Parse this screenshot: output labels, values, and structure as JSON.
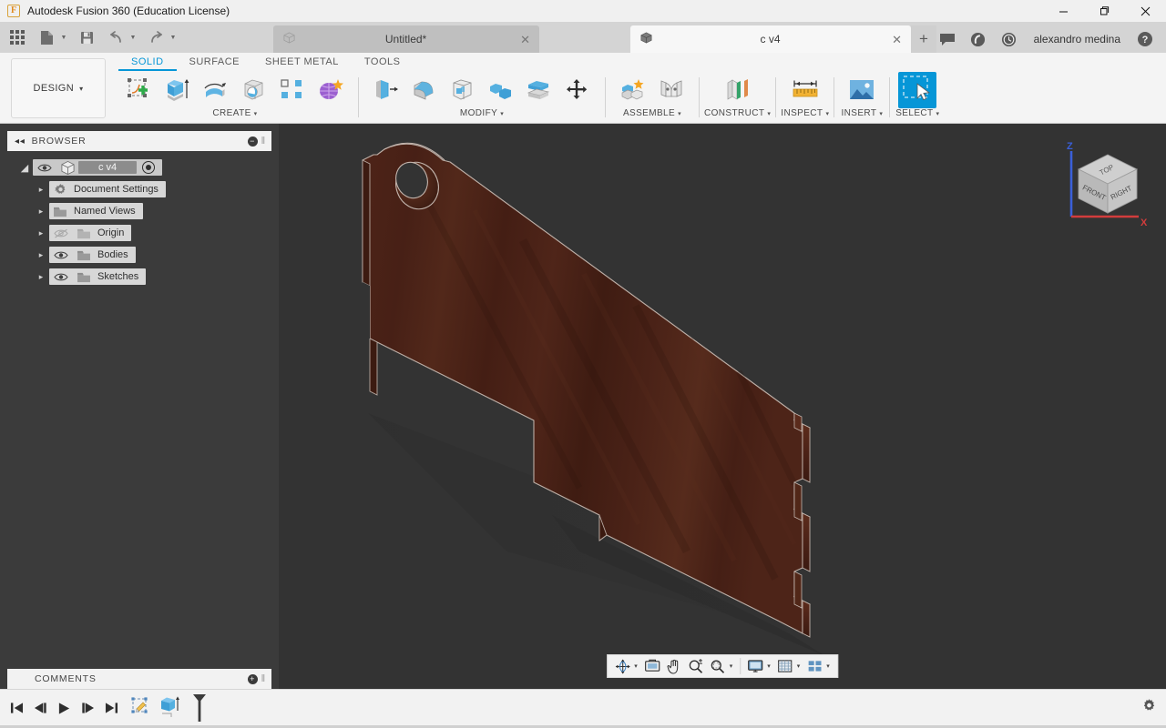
{
  "window": {
    "app_title": "Autodesk Fusion 360 (Education License)",
    "logo_letter": "F",
    "minimize_label": "—",
    "maximize_label": "❐",
    "close_label": "✕"
  },
  "quick_access": {
    "items": [
      {
        "name": "app-grid-icon",
        "label": "Show Data Panel"
      },
      {
        "name": "file-icon",
        "label": "File"
      },
      {
        "name": "save-icon",
        "label": "Save"
      },
      {
        "name": "undo-icon",
        "label": "Undo"
      },
      {
        "name": "redo-icon",
        "label": "Redo"
      }
    ]
  },
  "document_tabs": [
    {
      "label": "Untitled*",
      "active": false,
      "close_label": "✕"
    },
    {
      "label": "c v4",
      "active": true,
      "close_label": "✕"
    }
  ],
  "tab_strip_right": {
    "new_tab_label": "+",
    "buttons": [
      {
        "name": "comments-icon",
        "label": "Comments"
      },
      {
        "name": "job-status-icon",
        "label": "Job Status"
      },
      {
        "name": "recent-icon",
        "label": "Recent"
      }
    ],
    "username": "alexandro medina",
    "help_label": "?"
  },
  "ribbon": {
    "workspace_label": "DESIGN",
    "workspace_caret": "▾",
    "tabs": [
      {
        "label": "SOLID",
        "active": true
      },
      {
        "label": "SURFACE",
        "active": false
      },
      {
        "label": "SHEET METAL",
        "active": false
      },
      {
        "label": "TOOLS",
        "active": false
      }
    ],
    "panels": [
      {
        "label": "CREATE",
        "caret": "▾",
        "tools": [
          {
            "name": "create-sketch-icon",
            "label": "Create Sketch"
          },
          {
            "name": "extrude-icon",
            "label": "Extrude"
          },
          {
            "name": "revolve-icon",
            "label": "Revolve"
          },
          {
            "name": "sphere-icon",
            "label": "Sphere"
          },
          {
            "name": "pattern-icon",
            "label": "Pattern"
          },
          {
            "name": "form-icon",
            "label": "Create Form"
          }
        ]
      },
      {
        "label": "MODIFY",
        "caret": "▾",
        "tools": [
          {
            "name": "press-pull-icon",
            "label": "Press Pull"
          },
          {
            "name": "fillet-icon",
            "label": "Fillet"
          },
          {
            "name": "shell-icon",
            "label": "Shell"
          },
          {
            "name": "combine-icon",
            "label": "Combine"
          },
          {
            "name": "split-face-icon",
            "label": "Split Face"
          },
          {
            "name": "move-copy-icon",
            "label": "Move/Copy"
          }
        ]
      },
      {
        "label": "ASSEMBLE",
        "caret": "▾",
        "tools": [
          {
            "name": "new-component-icon",
            "label": "New Component"
          },
          {
            "name": "joint-icon",
            "label": "Joint"
          }
        ]
      },
      {
        "label": "CONSTRUCT",
        "caret": "▾",
        "tools": [
          {
            "name": "offset-plane-icon",
            "label": "Offset Plane"
          }
        ]
      },
      {
        "label": "INSPECT",
        "caret": "▾",
        "tools": [
          {
            "name": "measure-icon",
            "label": "Measure"
          }
        ]
      },
      {
        "label": "INSERT",
        "caret": "▾",
        "tools": [
          {
            "name": "insert-image-icon",
            "label": "Decal"
          }
        ]
      },
      {
        "label": "SELECT",
        "caret": "▾",
        "tools": [
          {
            "name": "select-icon",
            "label": "Select",
            "selected": true
          }
        ]
      }
    ]
  },
  "browser": {
    "title": "BROWSER",
    "collapse_label": "◂◂",
    "dot_label": "−",
    "grip_label": "‖",
    "root": {
      "label": "c v4",
      "twist": "◢",
      "visible": true
    },
    "items": [
      {
        "label": "Document Settings",
        "icon": "gear-icon",
        "twist": "▸",
        "eye": false
      },
      {
        "label": "Named Views",
        "icon": "folder-icon",
        "twist": "▸",
        "eye": false
      },
      {
        "label": "Origin",
        "icon": "folder-icon",
        "twist": "▸",
        "eye": true,
        "eye_off": true
      },
      {
        "label": "Bodies",
        "icon": "folder-icon",
        "twist": "▸",
        "eye": true,
        "eye_off": false
      },
      {
        "label": "Sketches",
        "icon": "folder-icon",
        "twist": "▸",
        "eye": true,
        "eye_off": false
      }
    ]
  },
  "comments": {
    "title": "COMMENTS",
    "add_label": "+",
    "grip_label": "‖"
  },
  "viewport": {
    "background_color": "#333333",
    "model": {
      "name": "wooden-board-body",
      "face_color": "#4c2418",
      "edge_color": "#c9bdb6",
      "side_color": "#3a1a10",
      "top_edge_color": "#5a2d1d"
    },
    "viewcube": {
      "faces": [
        "TOP",
        "FRONT",
        "RIGHT"
      ],
      "axes": [
        {
          "label": "Z",
          "color": "#3a5fd8"
        },
        {
          "label": "X",
          "color": "#d23c3c"
        }
      ]
    },
    "navbar": {
      "buttons": [
        {
          "name": "orbit-icon",
          "label": "Orbit",
          "caret": "▾"
        },
        {
          "name": "look-at-icon",
          "label": "Look At",
          "caret": ""
        },
        {
          "name": "pan-icon",
          "label": "Pan",
          "caret": ""
        },
        {
          "name": "zoom-icon",
          "label": "Zoom",
          "caret": ""
        },
        {
          "name": "fit-icon",
          "label": "Fit",
          "caret": "▾"
        },
        {
          "name": "display-settings-icon",
          "label": "Display Settings",
          "caret": "▾"
        },
        {
          "name": "grid-snaps-icon",
          "label": "Grid and Snaps",
          "caret": "▾"
        },
        {
          "name": "viewport-layout-icon",
          "label": "Viewports",
          "caret": "▾"
        }
      ]
    }
  },
  "timeline": {
    "controls": [
      {
        "name": "jump-to-beginning-icon",
        "label": "Jump to Beginning"
      },
      {
        "name": "step-back-icon",
        "label": "Step Back"
      },
      {
        "name": "play-icon",
        "label": "Play"
      },
      {
        "name": "step-forward-icon",
        "label": "Step Forward"
      },
      {
        "name": "jump-to-end-icon",
        "label": "Jump to End"
      }
    ],
    "features": [
      {
        "name": "timeline-sketch-icon",
        "label": "Sketch"
      },
      {
        "name": "timeline-extrude-icon",
        "label": "Extrude"
      }
    ],
    "settings_label": "Settings"
  }
}
